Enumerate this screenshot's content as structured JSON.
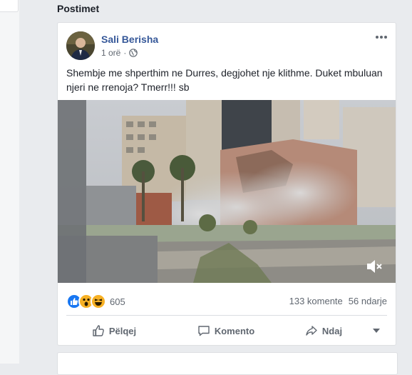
{
  "section": {
    "title": "Postimet"
  },
  "post": {
    "author": "Sali Berisha",
    "time": "1 orë",
    "visibility_icon": "globe-icon",
    "text": "Shembje me shperthim ne Durres, degjohet nje klithme. Duket mbuluan njeri ne rrenoja? Tmerr!!! sb",
    "reactions": {
      "icons": [
        "like-icon",
        "wow-icon",
        "haha-icon"
      ],
      "count": "605"
    },
    "comments": "133 komente",
    "shares": "56 ndarje",
    "actions": {
      "like": "Pëlqej",
      "comment": "Komento",
      "share": "Ndaj"
    },
    "colors": {
      "author": "#365899",
      "like_blue": "#1877f2",
      "reaction_yellow": "#f7b125"
    }
  }
}
